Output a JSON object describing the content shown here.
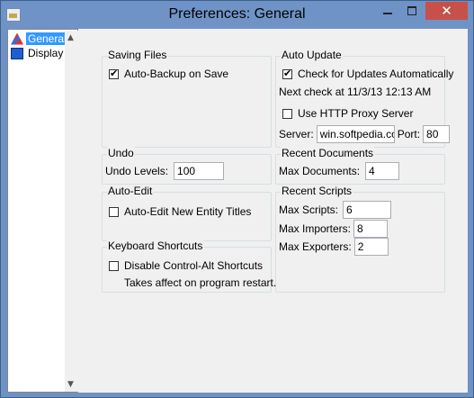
{
  "window": {
    "title": "Preferences: General",
    "close_glyph": "✕"
  },
  "tree": {
    "items": [
      {
        "label": "General",
        "icon": "general-icon",
        "selected": true
      },
      {
        "label": "Display",
        "icon": "display-icon",
        "selected": false
      }
    ],
    "scroll_up": "▲",
    "scroll_down": "▼"
  },
  "saving": {
    "title": "Saving Files",
    "auto_backup": {
      "label": "Auto-Backup on Save",
      "checked": true
    }
  },
  "auto_update": {
    "title": "Auto Update",
    "check": {
      "label": "Check for Updates Automatically",
      "checked": true
    },
    "next_check": "Next check at 11/3/13 12:13 AM",
    "proxy": {
      "label": "Use HTTP Proxy Server",
      "checked": false
    },
    "server_label": "Server:",
    "server_value": "win.softpedia.co",
    "port_label": "Port:",
    "port_value": "80"
  },
  "undo": {
    "title": "Undo",
    "levels_label": "Undo Levels:",
    "levels_value": "100"
  },
  "recent_docs": {
    "title": "Recent Documents",
    "max_label": "Max Documents:",
    "max_value": "4"
  },
  "auto_edit": {
    "title": "Auto-Edit",
    "option": {
      "label": "Auto-Edit New Entity Titles",
      "checked": false
    }
  },
  "recent_scripts": {
    "title": "Recent Scripts",
    "scripts_label": "Max Scripts:",
    "scripts_value": "6",
    "importers_label": "Max Importers:",
    "importers_value": "8",
    "exporters_label": "Max Exporters:",
    "exporters_value": "2"
  },
  "keyboard": {
    "title": "Keyboard Shortcuts",
    "option": {
      "label": "Disable Control-Alt Shortcuts",
      "checked": false
    },
    "note": "Takes affect on program restart."
  }
}
